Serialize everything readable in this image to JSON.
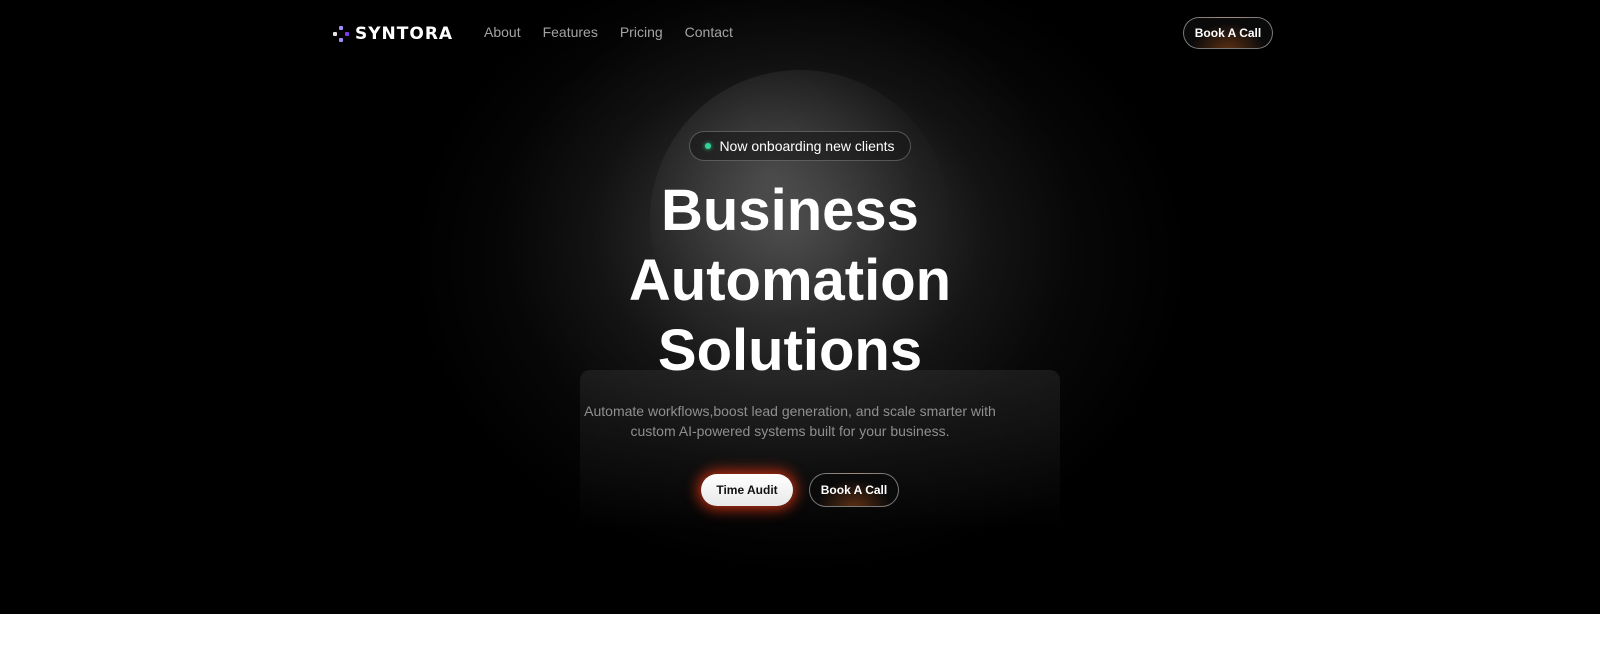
{
  "brand": {
    "name": "SYNTORA",
    "logo_icon": "diamond-dots-logo-icon",
    "accent_color": "#a78bfa"
  },
  "nav": {
    "links": [
      {
        "label": "About"
      },
      {
        "label": "Features"
      },
      {
        "label": "Pricing"
      },
      {
        "label": "Contact"
      }
    ],
    "cta_label": "Book A Call"
  },
  "hero": {
    "badge": {
      "text": "Now onboarding new clients",
      "status_color": "#34d399"
    },
    "headline": "Business Automation Solutions",
    "subtitle": "Automate workflows,boost lead generation, and scale smarter with custom AI-powered systems built for your business.",
    "primary_button": "Time Audit",
    "secondary_button": "Book A Call",
    "glow_color": "#ff3c14"
  }
}
